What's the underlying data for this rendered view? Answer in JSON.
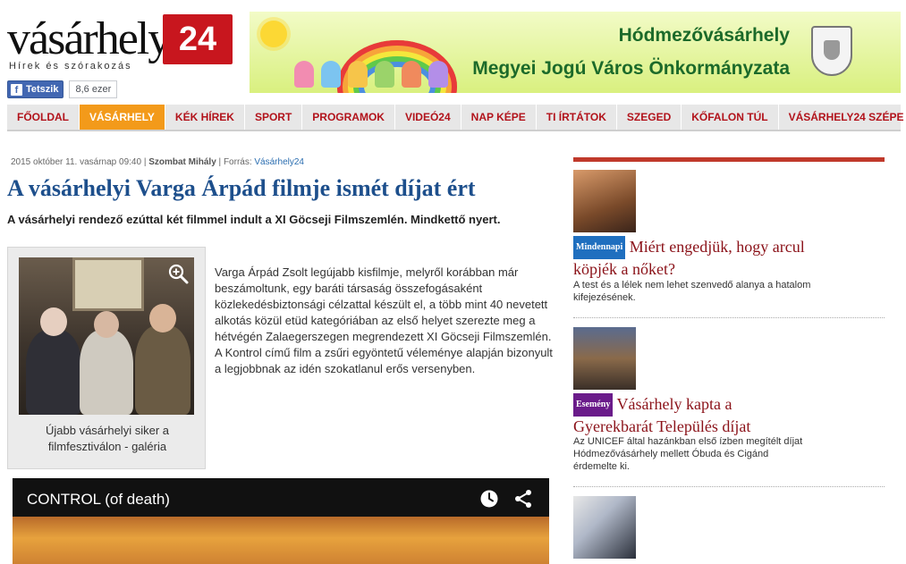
{
  "logo": {
    "word": "vásárhely",
    "number": "24",
    "tagline": "Hírek és szórakozás"
  },
  "facebook": {
    "like_label": "Tetszik",
    "count": "8,6 ezer",
    "icon": "facebook-icon"
  },
  "banner": {
    "line1": "Hódmezővásárhely",
    "line2": "Megyei Jogú Város Önkormányzata"
  },
  "nav": {
    "items": [
      {
        "label": "FŐOLDAL"
      },
      {
        "label": "VÁSÁRHELY"
      },
      {
        "label": "KÉK HÍREK"
      },
      {
        "label": "SPORT"
      },
      {
        "label": "PROGRAMOK"
      },
      {
        "label": "VIDEÓ24"
      },
      {
        "label": "NAP KÉPE"
      },
      {
        "label": "TI ÍRTÁTOK"
      },
      {
        "label": "SZEGED"
      },
      {
        "label": "KŐFALON TÚL"
      },
      {
        "label": "VÁSÁRHELY24 SZÉPE"
      }
    ],
    "active": "VÁSÁRHELY"
  },
  "article": {
    "date": "2015 október 11. vasárnap 09:40",
    "author": "Szombat Mihály",
    "source_label": "Forrás:",
    "source": "Vásárhely24",
    "title": "A vásárhelyi Varga Árpád filmje ismét díjat ért",
    "lead": "A vásárhelyi rendező ezúttal két filmmel indult a XI Göcseji Filmszemlén. Mindkettő nyert.",
    "photo_caption": "Újabb vásárhelyi siker a filmfesztiválon - galéria",
    "body": "Varga Árpád Zsolt legújabb kisfilmje, melyről korábban már beszámoltunk, egy baráti társaság összefogásaként közlekedésbiztonsági célzattal készült el, a több mint 40 nevetett alkotás közül etüd kategóriában az első helyet szerezte meg a hétvégén Zalaegerszegen megrendezett XI Göcseji Filmszemlén. A Kontrol című film a zsűri egyöntetű véleménye alapján bizonyult a legjobbnak az idén szokatlanul erős versenyben."
  },
  "video": {
    "title": "CONTROL (of death)"
  },
  "sidebar": {
    "items": [
      {
        "category": "Mindennapi",
        "category_color": "#1f6fbf",
        "headline": "Miért engedjük, hogy arcul köpjék a nőket?",
        "desc": "A test és a lélek nem lehet szenvedő alanya a hatalom kifejezésének."
      },
      {
        "category": "Esemény",
        "category_color": "#6a1b8a",
        "headline": "Vásárhely kapta a Gyerekbarát Település díjat",
        "desc": "Az UNICEF által hazánkban első ízben megítélt díjat Hódmezővásárhely mellett Óbuda és Cigánd érdemelte ki."
      }
    ]
  },
  "colors": {
    "accent": "#c8161e",
    "nav_active": "#f39a1a",
    "title": "#1d4f8c",
    "headline": "#8b1219"
  }
}
